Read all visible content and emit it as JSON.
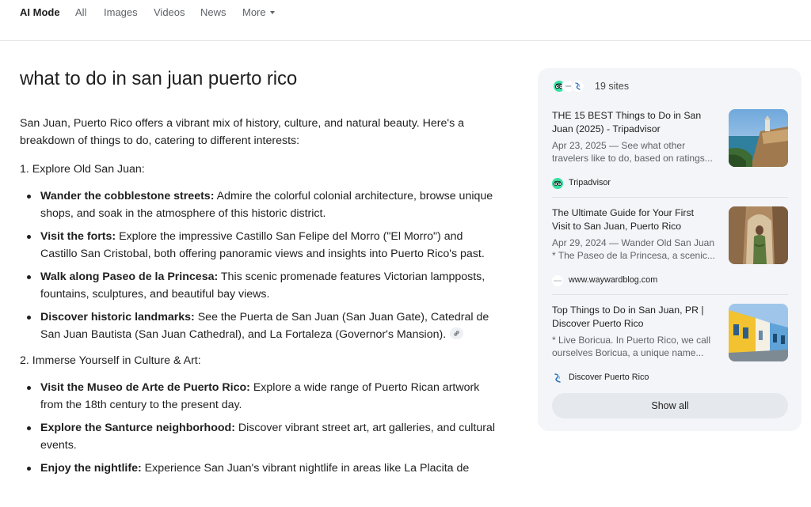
{
  "nav": {
    "tabs": [
      {
        "label": "AI Mode",
        "active": true
      },
      {
        "label": "All"
      },
      {
        "label": "Images"
      },
      {
        "label": "Videos"
      },
      {
        "label": "News"
      },
      {
        "label": "More"
      }
    ]
  },
  "query": "what to do in san juan puerto rico",
  "answer": {
    "intro": "San Juan, Puerto Rico offers a vibrant mix of history, culture, and natural beauty. Here's a breakdown of things to do, catering to different interests:",
    "sections": [
      {
        "heading": "1. Explore Old San Juan:",
        "items": [
          {
            "title": "Wander the cobblestone streets:",
            "text": "Admire the colorful colonial architecture, browse unique shops, and soak in the atmosphere of this historic district."
          },
          {
            "title": "Visit the forts:",
            "text": "Explore the impressive Castillo San Felipe del Morro (\"El Morro\") and Castillo San Cristobal, both offering panoramic views and insights into Puerto Rico's past."
          },
          {
            "title": "Walk along Paseo de la Princesa:",
            "text": "This scenic promenade features Victorian lampposts, fountains, sculptures, and beautiful bay views."
          },
          {
            "title": "Discover historic landmarks:",
            "text": "See the Puerta de San Juan (San Juan Gate), Catedral de San Juan Bautista (San Juan Cathedral), and La Fortaleza (Governor's Mansion).",
            "citation_icon": "link-icon"
          }
        ]
      },
      {
        "heading": "2. Immerse Yourself in Culture & Art:",
        "items": [
          {
            "title": "Visit the Museo de Arte de Puerto Rico:",
            "text": "Explore a wide range of Puerto Rican artwork from the 18th century to the present day."
          },
          {
            "title": "Explore the Santurce neighborhood:",
            "text": "Discover vibrant street art, art galleries, and cultural events."
          },
          {
            "title": "Enjoy the nightlife:",
            "text": "Experience San Juan's vibrant nightlife in areas like La Placita de"
          }
        ]
      }
    ]
  },
  "sources": {
    "count_label": "19 sites",
    "header_icons": [
      "tripadvisor-icon",
      "waywardblog-icon",
      "discover-puerto-rico-icon"
    ],
    "cards": [
      {
        "title": "THE 15 BEST Things to Do in San Juan (2025) - Tripadvisor",
        "snippet_lines": [
          "Apr 23, 2025 — See what other",
          "travelers like to do, based on ratings..."
        ],
        "source": "Tripadvisor",
        "source_icon": "tripadvisor-icon",
        "thumb": "coastal-fort-photo"
      },
      {
        "title": "The Ultimate Guide for Your First Visit to San Juan, Puerto Rico",
        "snippet_lines": [
          "Apr 29, 2024 — Wander Old San Juan",
          "* The Paseo de la Princesa, a scenic..."
        ],
        "source": "www.waywardblog.com",
        "source_icon": "waywardblog-icon",
        "thumb": "person-in-stone-arch-photo"
      },
      {
        "title": "Top Things to Do in San Juan, PR | Discover Puerto Rico",
        "snippet_lines": [
          "* Live Boricua. In Puerto Rico, we call",
          "ourselves Boricua, a unique name..."
        ],
        "source": "Discover Puerto Rico",
        "source_icon": "discover-puerto-rico-icon",
        "thumb": "colorful-street-photo"
      }
    ],
    "show_all_label": "Show all"
  },
  "colors": {
    "tripadvisor_green": "#34e0a1",
    "discover_pr_blue": "#2c6fb7",
    "panel_bg": "#f3f5f8"
  }
}
